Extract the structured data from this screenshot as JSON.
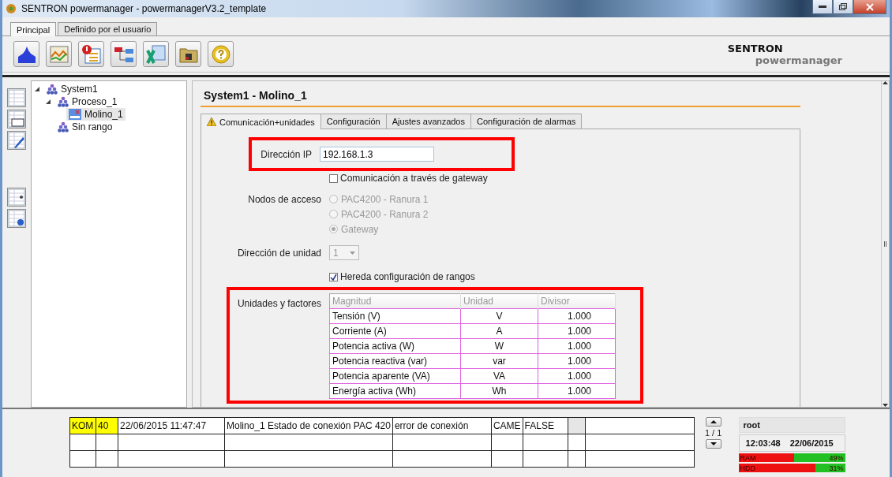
{
  "window": {
    "title": "SENTRON powermanager - powermanagerV3.2_template"
  },
  "ribbon_tabs": [
    {
      "label": "Principal",
      "selected": true
    },
    {
      "label": "Definido por el usuario",
      "selected": false
    }
  ],
  "toolbar": [
    {
      "kind": "area"
    },
    {
      "kind": "line"
    },
    {
      "kind": "alert"
    },
    {
      "kind": "tree"
    },
    {
      "kind": "sheet"
    },
    {
      "kind": "folder"
    },
    {
      "kind": "help"
    }
  ],
  "brand": {
    "name": "SENTRON",
    "product": "powermanager"
  },
  "side_tools": [
    {
      "kind": "table"
    },
    {
      "kind": "chart"
    },
    {
      "kind": "edit"
    },
    {
      "kind": "gap"
    },
    {
      "kind": "user"
    },
    {
      "kind": "gear"
    }
  ],
  "tree": [
    {
      "label": "System1",
      "expanded": true,
      "selected": false,
      "kind": "group",
      "children": [
        {
          "label": "Proceso_1",
          "expanded": true,
          "selected": false,
          "kind": "group",
          "children": [
            {
              "label": "Molino_1",
              "selected": true,
              "kind": "device"
            }
          ]
        },
        {
          "label": "Sin rango",
          "selected": false,
          "kind": "group"
        }
      ]
    }
  ],
  "content": {
    "title": "System1 - Molino_1",
    "tabs": [
      {
        "label": "Comunicación+unidades",
        "selected": true,
        "warning": true
      },
      {
        "label": "Configuración",
        "selected": false,
        "warning": false
      },
      {
        "label": "Ajustes avanzados",
        "selected": false,
        "warning": false
      },
      {
        "label": "Configuración de alarmas",
        "selected": false,
        "warning": false
      }
    ],
    "ip": {
      "label": "Dirección IP",
      "value": "192.168.1.3",
      "highlighted": true
    },
    "gateway": {
      "label": "Comunicación a través de gateway",
      "checked": false
    },
    "access_nodes": {
      "label": "Nodos de acceso",
      "disabled": true,
      "options": [
        {
          "label": "PAC4200 - Ranura 1",
          "selected": false
        },
        {
          "label": "PAC4200 - Ranura 2",
          "selected": false
        },
        {
          "label": "Gateway",
          "selected": true
        }
      ]
    },
    "unit_address": {
      "label": "Dirección de unidad",
      "value": "1",
      "disabled": true
    },
    "inherit": {
      "label": "Hereda configuración de rangos",
      "checked": true
    },
    "units": {
      "label": "Unidades y factores",
      "highlighted": true,
      "columns": [
        "Magnitud",
        "Unidad",
        "Divisor"
      ],
      "rows": [
        [
          "Tensión (V)",
          "V",
          "1.000"
        ],
        [
          "Corriente (A)",
          "A",
          "1.000"
        ],
        [
          "Potencia activa (W)",
          "W",
          "1.000"
        ],
        [
          "Potencia reactiva (var)",
          "var",
          "1.000"
        ],
        [
          "Potencia aparente (VA)",
          "VA",
          "1.000"
        ],
        [
          "Energía activa (Wh)",
          "Wh",
          "1.000"
        ]
      ]
    }
  },
  "alarms": {
    "rows": [
      [
        {
          "text": "KOM",
          "flag": true
        },
        {
          "text": "40",
          "flag": true
        },
        {
          "text": "22/06/2015 11:47:47"
        },
        {
          "text": "Molino_1 Estado de conexión PAC 420"
        },
        {
          "text": "error de conexión"
        },
        {
          "text": "CAME"
        },
        {
          "text": "FALSE"
        },
        {
          "text": "",
          "grey": true
        },
        {
          "text": ""
        }
      ],
      [
        {
          "text": ""
        },
        {
          "text": ""
        },
        {
          "text": ""
        },
        {
          "text": ""
        },
        {
          "text": ""
        },
        {
          "text": ""
        },
        {
          "text": ""
        },
        {
          "text": ""
        },
        {
          "text": ""
        }
      ],
      [
        {
          "text": ""
        },
        {
          "text": ""
        },
        {
          "text": ""
        },
        {
          "text": ""
        },
        {
          "text": ""
        },
        {
          "text": ""
        },
        {
          "text": ""
        },
        {
          "text": ""
        },
        {
          "text": ""
        }
      ]
    ],
    "page": "1 / 1"
  },
  "status": {
    "user": "root",
    "time": "12:03:48",
    "date": "22/06/2015",
    "meters": [
      {
        "label": "RAM",
        "reading": "49%",
        "level": 0.52
      },
      {
        "label": "HDD",
        "reading": "31%",
        "level": 0.72
      }
    ]
  }
}
